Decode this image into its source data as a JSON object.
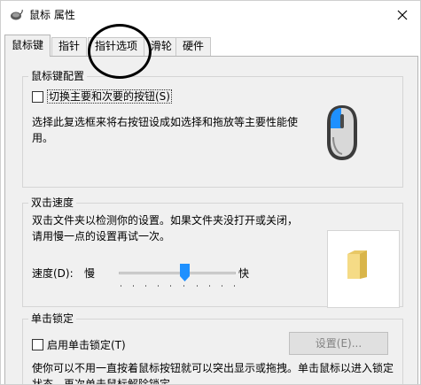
{
  "window": {
    "title": "鼠标 属性",
    "icon": "mouse-icon",
    "close_icon": "close-icon"
  },
  "tabs": [
    {
      "label": "鼠标键",
      "active": true
    },
    {
      "label": "指针",
      "active": false
    },
    {
      "label": "指针选项",
      "active": false
    },
    {
      "label": "滑轮",
      "active": false
    },
    {
      "label": "硬件",
      "active": false
    }
  ],
  "button_config": {
    "group_title": "鼠标键配置",
    "checkbox_label": "切换主要和次要的按钮(S)",
    "checked": false,
    "description": "选择此复选框来将右按钮设成如选择和拖放等主要性能使用。",
    "illustration_icon": "mouse-primary-left-icon"
  },
  "double_click": {
    "group_title": "双击速度",
    "description": "双击文件夹以检测你的设置。如果文件夹没打开或关闭，请用慢一点的设置再试一次。",
    "speed_label": "速度(D):",
    "slow_label": "慢",
    "fast_label": "快",
    "speed_value": 0.5,
    "test_icon": "folder-icon"
  },
  "click_lock": {
    "group_title": "单击锁定",
    "checkbox_label": "启用单击锁定(T)",
    "checked": false,
    "settings_button": "设置(E)...",
    "description": "使你可以不用一直按着鼠标按钮就可以突出显示或拖拽。单击鼠标以进入锁定状态，再次单击鼠标解除锁定。"
  },
  "colors": {
    "accent": "#1e90ff",
    "panel_bg": "#f0f0f0",
    "disabled_text": "#838383"
  }
}
